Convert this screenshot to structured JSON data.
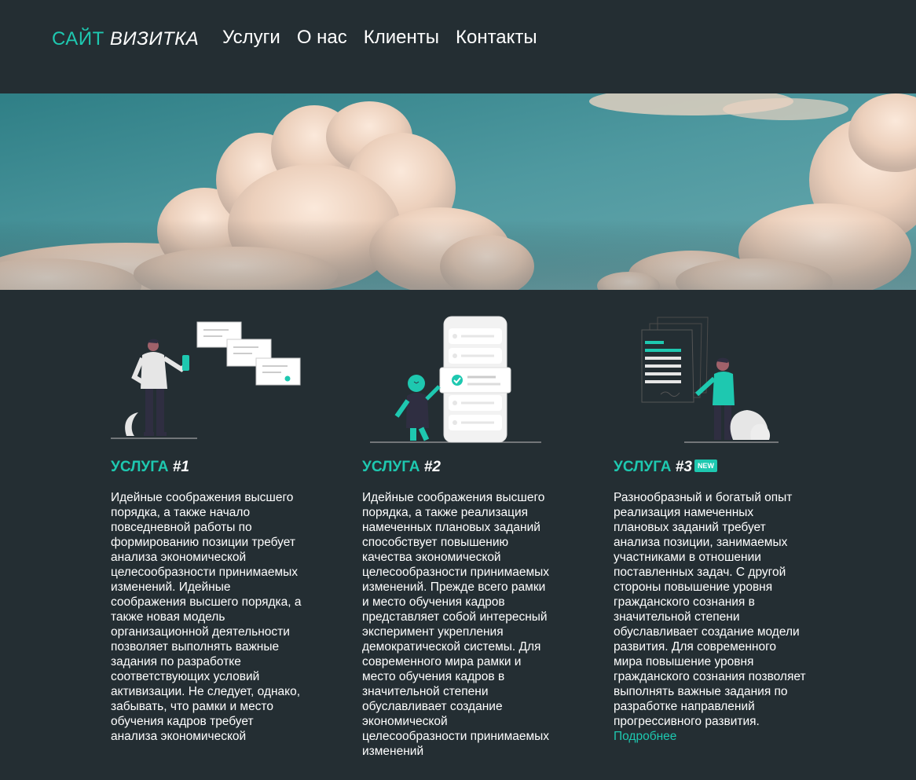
{
  "header": {
    "logo_part1": "САЙТ",
    "logo_part2": "ВИЗИТКА",
    "nav": [
      "Услуги",
      "О нас",
      "Клиенты",
      "Контакты"
    ]
  },
  "colors": {
    "accent": "#1ec8b0",
    "background": "#242e33"
  },
  "services": [
    {
      "title1": "УСЛУГА",
      "title2": "#1",
      "text": "Идейные соображения высшего порядка, а также начало повседневной работы по формированию позиции требует анализа экономической целесообразности принимаемых изменений. Идейные соображения высшего порядка, а также новая модель организационной деятельности позволяет выполнять важные задания по разработке соответствующих условий активизации. Не следует, однако, забывать, что рамки и место обучения кадров требует анализа экономической"
    },
    {
      "title1": "УСЛУГА",
      "title2": "#2",
      "text": "Идейные соображения высшего порядка, а также реализация намеченных плановых заданий способствует повышению качества экономической целесообразности принимаемых изменений. Прежде всего рамки и место обучения кадров представляет собой интересный эксперимент укрепления демократической системы. Для современного мира рамки и место обучения кадров в значительной степени обуславливает создание экономической целесообразности принимаемых изменений"
    },
    {
      "title1": "УСЛУГА",
      "title2": "#3",
      "badge": "NEW",
      "text": "Разнообразный и богатый опыт реализация намеченных плановых заданий требует анализа позиции, занимаемых участниками в отношении поставленных задач. С другой стороны повышение уровня гражданского сознания в значительной степени обуславливает создание модели развития. Для современного мира повышение уровня гражданского сознания позволяет выполнять важные задания по разработке направлений прогрессивного развития.",
      "link": "Подробнее"
    }
  ]
}
